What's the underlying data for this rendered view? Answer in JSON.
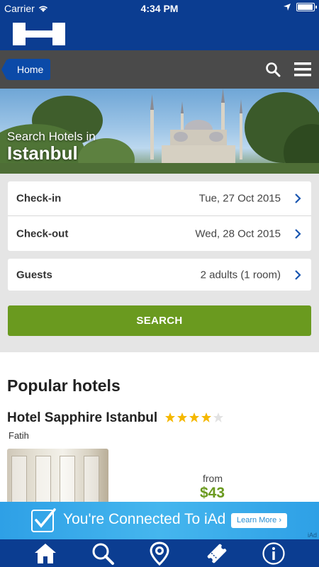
{
  "status_bar": {
    "carrier": "Carrier",
    "time": "4:34 PM"
  },
  "app": {
    "logo_icon": "hotels-h-logo-icon"
  },
  "nav": {
    "home_label": "Home",
    "search_icon": "search-icon",
    "menu_icon": "menu-icon"
  },
  "hero": {
    "subtitle": "Search Hotels in",
    "city": "Istanbul"
  },
  "form": {
    "checkin": {
      "label": "Check-in",
      "value": "Tue, 27 Oct 2015"
    },
    "checkout": {
      "label": "Check-out",
      "value": "Wed, 28 Oct 2015"
    },
    "guests": {
      "label": "Guests",
      "value": "2 adults (1 room)"
    },
    "search_label": "SEARCH"
  },
  "popular": {
    "title": "Popular hotels",
    "hotels": [
      {
        "name": "Hotel Sapphire Istanbul",
        "rating": 4,
        "max_rating": 5,
        "area": "Fatih",
        "from_label": "from",
        "price": "$43"
      }
    ]
  },
  "ad": {
    "text": "You're Connected To iAd",
    "button": "Learn More",
    "tag": "iAd"
  },
  "tabs": [
    {
      "name": "home-icon"
    },
    {
      "name": "search-icon"
    },
    {
      "name": "location-pin-icon"
    },
    {
      "name": "ticket-icon"
    },
    {
      "name": "info-icon"
    }
  ],
  "colors": {
    "brand_blue": "#0b3d91",
    "search_green": "#6a9a1f",
    "star_gold": "#f5b800"
  }
}
